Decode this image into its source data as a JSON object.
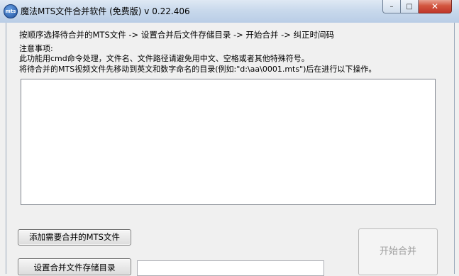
{
  "window": {
    "title": "魔法MTS文件合并软件 (免费版) v 0.22.406",
    "icon_label": "mts",
    "controls": {
      "minimize_icon": "–",
      "maximize_icon": "□",
      "close_icon": "✕"
    }
  },
  "instructions": {
    "steps": "按顺序选择待合并的MTS文件 -> 设置合并后文件存储目录  -> 开始合并 -> 纠正时间码",
    "note_title": "注意事项:",
    "note_line1": "此功能用cmd命令处理，文件名、文件路径请避免用中文、空格或者其他特殊符号。",
    "note_line2": "将待合并的MTS视频文件先移动到英文和数字命名的目录(例如:\"d:\\aa\\0001.mts\")后在进行以下操作。"
  },
  "log": {
    "content": ""
  },
  "buttons": {
    "add_files": "添加需要合并的MTS文件",
    "set_output_dir": "设置合并文件存储目录",
    "start_merge": "开始合并"
  },
  "output_dir": {
    "value": ""
  }
}
